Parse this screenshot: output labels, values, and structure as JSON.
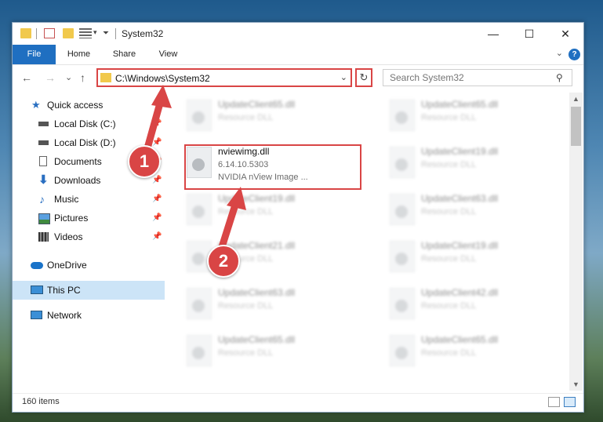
{
  "window": {
    "title": "System32",
    "controls": {
      "minimize": "—",
      "maximize": "☐",
      "close": "✕"
    }
  },
  "ribbon": {
    "tabs": [
      "File",
      "Home",
      "Share",
      "View"
    ],
    "help": "?",
    "collapse": "⌄"
  },
  "navigation": {
    "back": "←",
    "forward": "→",
    "recent": "⌄",
    "up": "↑",
    "address": "C:\\Windows\\System32",
    "address_dropdown": "⌄",
    "refresh": "↻",
    "search_placeholder": "Search System32",
    "search_icon": "⚲"
  },
  "sidebar": {
    "items": [
      {
        "label": "Quick access",
        "icon": "star-icon",
        "pinned": false
      },
      {
        "label": "Local Disk (C:)",
        "icon": "drive-icon",
        "pinned": true
      },
      {
        "label": "Local Disk (D:)",
        "icon": "drive-icon",
        "pinned": true
      },
      {
        "label": "Documents",
        "icon": "document-icon",
        "pinned": true
      },
      {
        "label": "Downloads",
        "icon": "download-icon",
        "pinned": true
      },
      {
        "label": "Music",
        "icon": "music-icon",
        "pinned": true
      },
      {
        "label": "Pictures",
        "icon": "pictures-icon",
        "pinned": true
      },
      {
        "label": "Videos",
        "icon": "video-icon",
        "pinned": true
      },
      {
        "label": "OneDrive",
        "icon": "cloud-icon",
        "pinned": false
      },
      {
        "label": "This PC",
        "icon": "computer-icon",
        "pinned": false,
        "selected": true
      },
      {
        "label": "Network",
        "icon": "network-icon",
        "pinned": false
      }
    ],
    "pin_glyph": "📌"
  },
  "files": {
    "left_column": [
      {
        "name": "UpdateClient65.dll",
        "type": "Resource DLL"
      },
      {
        "name": "nviewimg.dll",
        "version": "6.14.10.5303",
        "description": "NVIDIA nView Image ...",
        "highlighted": true
      },
      {
        "name": "UpdateClient19.dll",
        "type": "Resource DLL"
      },
      {
        "name": "UpdateClient21.dll",
        "type": "Resource DLL"
      },
      {
        "name": "UpdateClient63.dll",
        "type": "Resource DLL"
      },
      {
        "name": "UpdateClient65.dll",
        "type": "Resource DLL"
      }
    ],
    "right_column": [
      {
        "name": "UpdateClient65.dll",
        "type": "Resource DLL"
      },
      {
        "name": "UpdateClient19.dll",
        "type": "Resource DLL"
      },
      {
        "name": "UpdateClient63.dll",
        "type": "Resource DLL"
      },
      {
        "name": "UpdateClient19.dll",
        "type": "Resource DLL"
      },
      {
        "name": "UpdateClient42.dll",
        "type": "Resource DLL"
      },
      {
        "name": "UpdateClient65.dll",
        "type": "Resource DLL"
      }
    ]
  },
  "status": {
    "item_count": "160 items"
  },
  "callouts": [
    {
      "number": "1"
    },
    {
      "number": "2"
    }
  ],
  "colors": {
    "accent": "#1f6fc1",
    "highlight": "#d94545",
    "selected": "#cce4f7"
  }
}
